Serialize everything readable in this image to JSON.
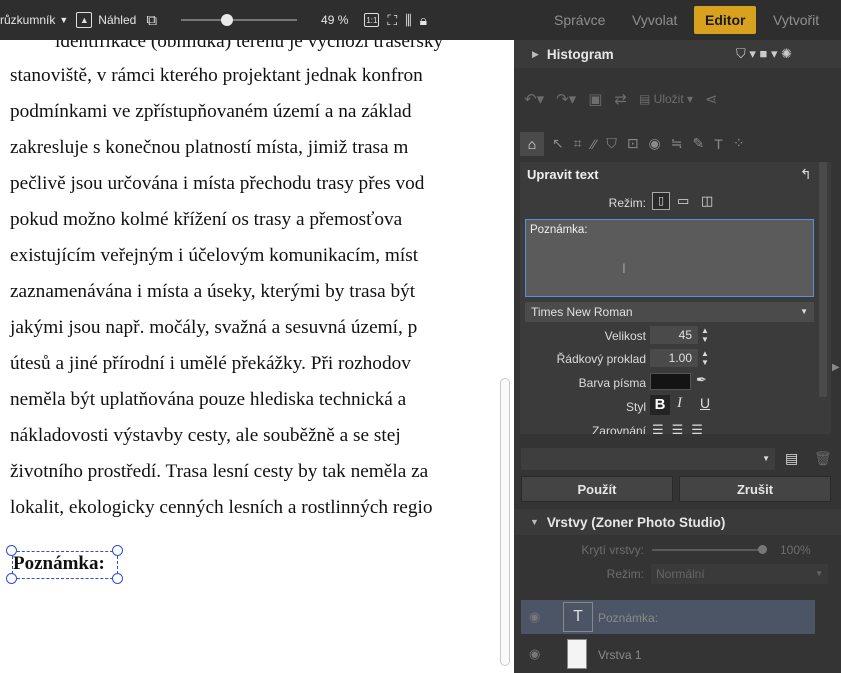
{
  "toolbar": {
    "guides_label": "růzkumník",
    "preview_label": "Náhled",
    "zoom": "49 %",
    "zoom_1to1": "1:1"
  },
  "modes": [
    "Správce",
    "Vyvolat",
    "Editor",
    "Vytvořit"
  ],
  "active_mode": "Editor",
  "document": {
    "lines": [
      "identifikace (obhlídka) terénu je výchozí trasérský",
      "stanoviště, v rámci kterého projektant jednak konfron",
      "podmínkami ve zpřístupňovaném území a na základ",
      "zakresluje s konečnou platností místa, jimiž trasa m",
      "pečlivě jsou určována i místa přechodu trasy přes vod",
      "pokud možno kolmé křížení os trasy a přemosťova",
      "existujícím veřejným i účelovým komunikacím, míst",
      "zaznamenávána i místa a úseky, kterými by trasa být",
      "jakými jsou např. močály, svažná a sesuvná území, p",
      "útesů a jiné přírodní i umělé překážky. Při rozhodov",
      "neměla být uplatňována pouze hlediska technická a",
      "nákladovosti výstavby cesty, ale souběžně a se stej",
      "životního prostředí. Trasa lesní cesty by tak neměla za",
      "lokalit, ekologicky cenných lesních a rostlinných regio"
    ],
    "note_text": "Poznámka:"
  },
  "panel": {
    "histogram_title": "Histogram",
    "save_label": "Uložit",
    "edit_text_title": "Upravit text",
    "mode_label": "Režim:",
    "text_value": "Poznámka:",
    "font_name": "Times New Roman",
    "size_label": "Velikost",
    "size_value": "45",
    "line_spacing_label": "Řádkový proklad",
    "line_spacing_value": "1.00",
    "font_color_label": "Barva písma",
    "style_label": "Styl",
    "align_label": "Zarovnání",
    "apply_label": "Použít",
    "cancel_label": "Zrušit",
    "layers_title": "Vrstvy (Zoner Photo Studio)",
    "opacity_label": "Krytí vrstvy:",
    "opacity_value": "100%",
    "blend_label": "Režim:",
    "blend_value": "Normální",
    "layers": [
      {
        "name": "Poznámka:",
        "type": "text"
      },
      {
        "name": "Vrstva 1",
        "type": "image"
      }
    ]
  },
  "colors": {
    "accent": "#d9a21e",
    "selection": "#2d4fd8",
    "panel_bg": "#343434",
    "font_color": "#141414"
  }
}
